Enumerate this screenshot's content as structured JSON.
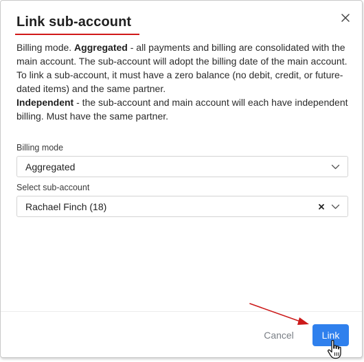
{
  "dialog": {
    "title": "Link sub-account",
    "description": {
      "p1_prefix": "Billing mode. ",
      "p1_bold": "Aggregated",
      "p1_rest": " - all payments and billing are consolidated with the main account. The sub-account will adopt the billing date of the main account. To link a sub-account, it must have a zero balance (no debit, credit, or future-dated items) and the same partner.",
      "p2_bold": "Independent",
      "p2_rest": " - the sub-account and main account will each have independent billing. Must have the same partner."
    },
    "billing_mode": {
      "label": "Billing mode",
      "value": "Aggregated"
    },
    "sub_account": {
      "label": "Select sub-account",
      "value": "Rachael Finch (18)"
    },
    "buttons": {
      "cancel": "Cancel",
      "link": "Link"
    }
  },
  "colors": {
    "accent_underline": "#d01818",
    "primary_button": "#2f80ed",
    "annotation_arrow": "#cc1a1a"
  },
  "icons": {
    "close": "close-icon",
    "dropdown": "chevron-down-icon",
    "clear": "clear-icon",
    "cursor": "hand-pointer-icon"
  }
}
